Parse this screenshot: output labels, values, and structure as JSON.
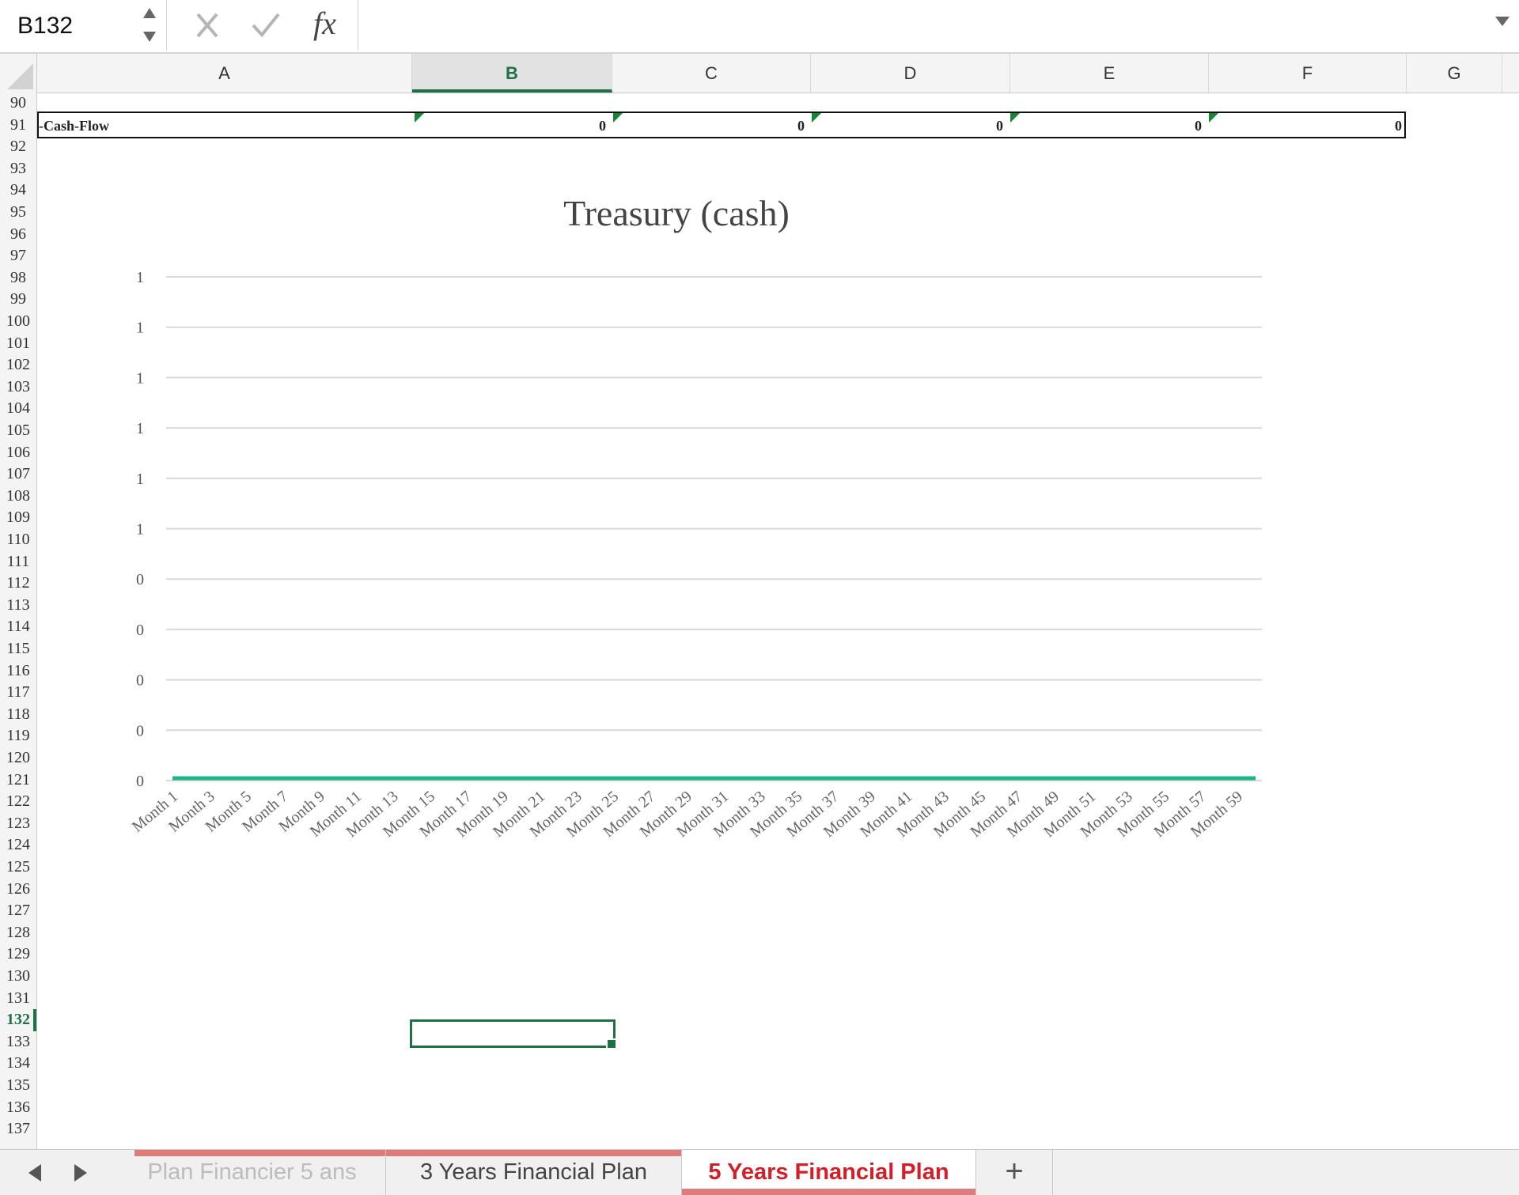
{
  "formula_bar": {
    "name_box": "B132",
    "fx_label": "fx",
    "formula": ""
  },
  "columns": [
    "A",
    "B",
    "C",
    "D",
    "E",
    "F",
    "G"
  ],
  "active_column": "B",
  "rows": [
    "90",
    "91",
    "92",
    "93",
    "94",
    "95",
    "96",
    "97",
    "98",
    "99",
    "100",
    "101",
    "102",
    "103",
    "104",
    "105",
    "106",
    "107",
    "108",
    "109",
    "110",
    "111",
    "112",
    "113",
    "114",
    "115",
    "116",
    "117",
    "118",
    "119",
    "120",
    "121",
    "122",
    "123",
    "124",
    "125",
    "126",
    "127",
    "128",
    "129",
    "130",
    "131",
    "132",
    "133",
    "134",
    "135",
    "136",
    "137"
  ],
  "active_row": "132",
  "cashflow_row": {
    "label": "-Cash-Flow",
    "values": [
      "0",
      "0",
      "0",
      "0",
      "0"
    ]
  },
  "chart_data": {
    "type": "line",
    "title": "Treasury (cash)",
    "xlabel": "",
    "ylabel": "",
    "y_tick_labels": [
      "1",
      "1",
      "1",
      "1",
      "1",
      "1",
      "0",
      "0",
      "0",
      "0",
      "0"
    ],
    "x_tick_labels": [
      "Month 1",
      "Month 3",
      "Month 5",
      "Month 7",
      "Month 9",
      "Month 11",
      "Month 13",
      "Month 15",
      "Month 17",
      "Month 19",
      "Month 21",
      "Month 23",
      "Month 25",
      "Month 27",
      "Month 29",
      "Month 31",
      "Month 33",
      "Month 35",
      "Month 37",
      "Month 39",
      "Month 41",
      "Month 43",
      "Month 45",
      "Month 47",
      "Month 49",
      "Month 51",
      "Month 53",
      "Month 55",
      "Month 57",
      "Month 59"
    ],
    "categories_count": 60,
    "series": [
      {
        "color": "#1fb58a",
        "value": 0
      }
    ],
    "ylim": [
      0,
      1
    ],
    "grid": true,
    "legend": "none"
  },
  "sheet_tabs": [
    {
      "label": "Plan Financier 5 ans",
      "active": false
    },
    {
      "label": "3 Years Financial Plan",
      "active": false
    },
    {
      "label": "5 Years Financial Plan",
      "active": true
    }
  ],
  "add_sheet_label": "+",
  "colors": {
    "accent": "#1e7145",
    "tab_active_text": "#d0202a",
    "tab_color": "#e07b7b",
    "series_line": "#1fb58a"
  }
}
